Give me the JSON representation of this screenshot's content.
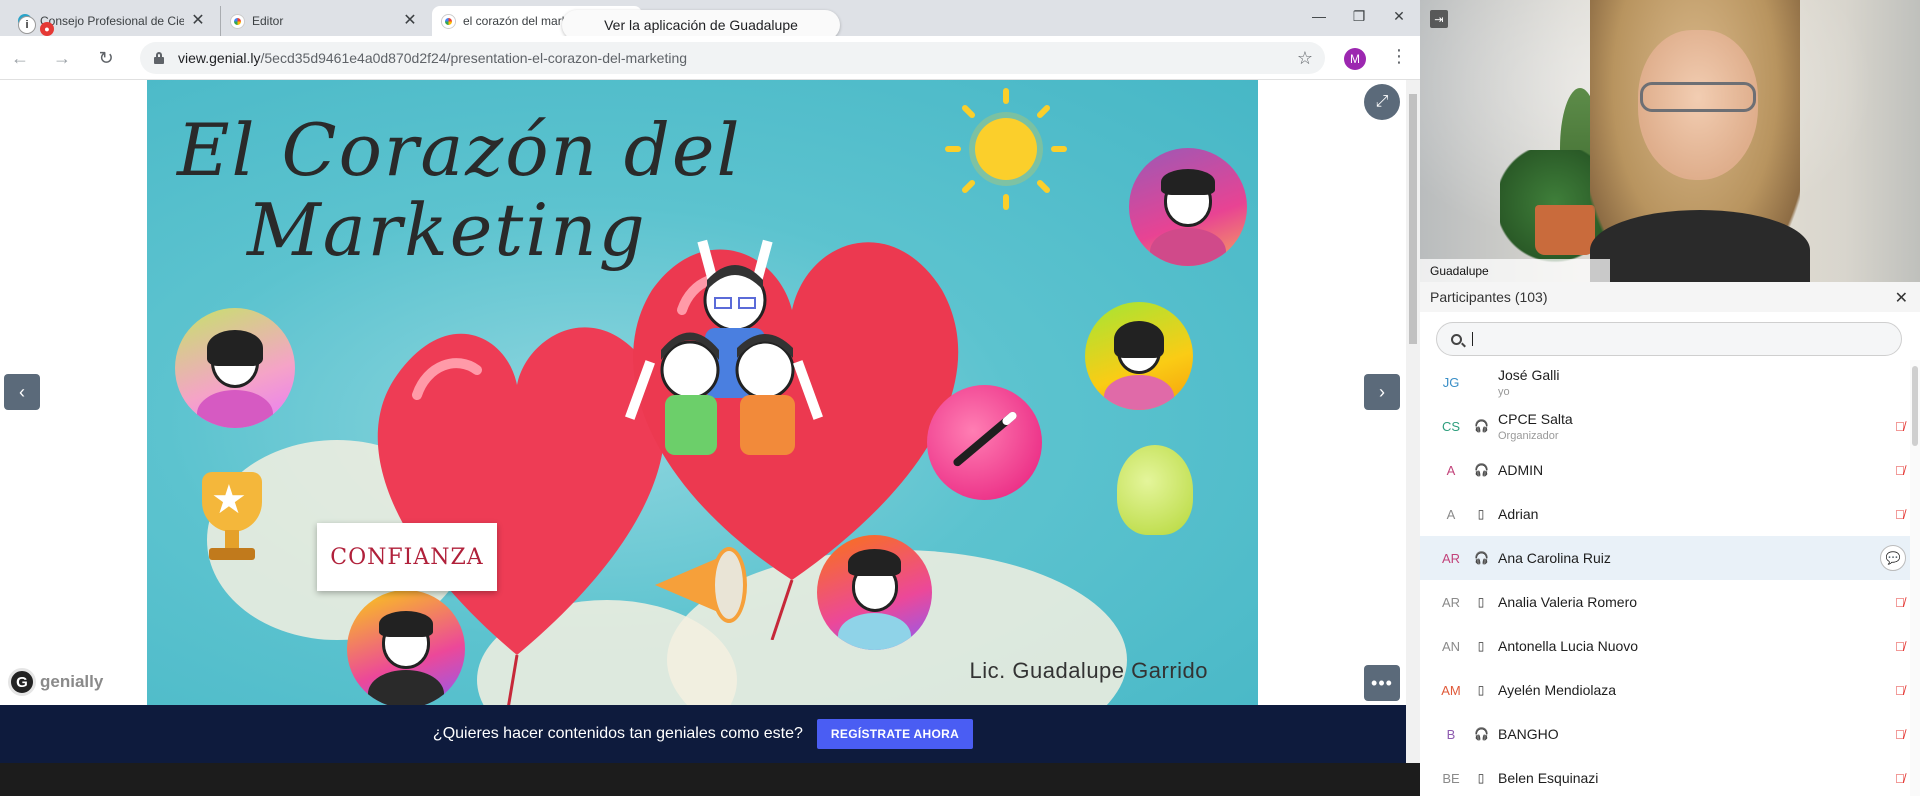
{
  "browser": {
    "tabs": [
      {
        "title": "Consejo Profesional de Ciencias",
        "close": "✕"
      },
      {
        "title": "Editor",
        "close": "✕"
      },
      {
        "title": "el corazón del marketing para",
        "close": "✕"
      }
    ],
    "new_tab": "+",
    "share_banner": "Ver la aplicación de Guadalupe",
    "window_controls": {
      "minimize": "—",
      "maximize": "❐",
      "close": "✕"
    },
    "nav": {
      "back": "←",
      "forward": "→",
      "reload": "↻"
    },
    "address": {
      "host": "view.genial.ly",
      "path": "/5ecd35d9461e4a0d870d2f24/presentation-el-corazon-del-marketing"
    },
    "star": "☆",
    "profile_initial": "M",
    "menu": "⋮"
  },
  "slide": {
    "title_line1": "El Corazón del",
    "title_line2": "Marketing",
    "confianza": "CONFIANZA",
    "author": "Lic. Guadalupe Garrido"
  },
  "viewer": {
    "prev": "‹",
    "next": "›",
    "fullscreen_icon": "⤢",
    "more": "•••",
    "brand": "genially",
    "brand_mark": "G"
  },
  "promo": {
    "text": "¿Quieres hacer contenidos tan geniales como este?",
    "cta": "REGÍSTRATE AHORA"
  },
  "meeting": {
    "video_name": "Guadalupe",
    "collapse_icon": "⇥",
    "participants_title": "Participantes (103)",
    "close": "✕",
    "search_value": "",
    "participants": [
      {
        "initials": "JG",
        "color": "#3a8fc7",
        "device": "",
        "name": "José Galli",
        "role": "yo",
        "status": "none"
      },
      {
        "initials": "CS",
        "color": "#2e9e7d",
        "device": "🎧",
        "name": "CPCE Salta",
        "role": "Organizador",
        "status": "muted"
      },
      {
        "initials": "A",
        "color": "#c2437a",
        "device": "🎧",
        "name": "ADMIN",
        "role": "",
        "status": "muted"
      },
      {
        "initials": "A",
        "color": "#8a8a8a",
        "device": "▯",
        "name": "Adrian",
        "role": "",
        "status": "muted"
      },
      {
        "initials": "AR",
        "color": "#c2437a",
        "device": "🎧",
        "name": "Ana Carolina Ruiz",
        "role": "",
        "status": "chat"
      },
      {
        "initials": "AR",
        "color": "#8a8a8a",
        "device": "▯",
        "name": "Analia Valeria Romero",
        "role": "",
        "status": "muted"
      },
      {
        "initials": "AN",
        "color": "#8a8a8a",
        "device": "▯",
        "name": "Antonella Lucia Nuovo",
        "role": "",
        "status": "muted"
      },
      {
        "initials": "AM",
        "color": "#e05a3a",
        "device": "▯",
        "name": "Ayelén Mendiolaza",
        "role": "",
        "status": "muted"
      },
      {
        "initials": "B",
        "color": "#8e5bb0",
        "device": "🎧",
        "name": "BANGHO",
        "role": "",
        "status": "muted"
      },
      {
        "initials": "BE",
        "color": "#8a8a8a",
        "device": "▯",
        "name": "Belen Esquinazi",
        "role": "",
        "status": "muted"
      }
    ],
    "mute_icon": "🎙̸",
    "chat_icon": "💬"
  }
}
